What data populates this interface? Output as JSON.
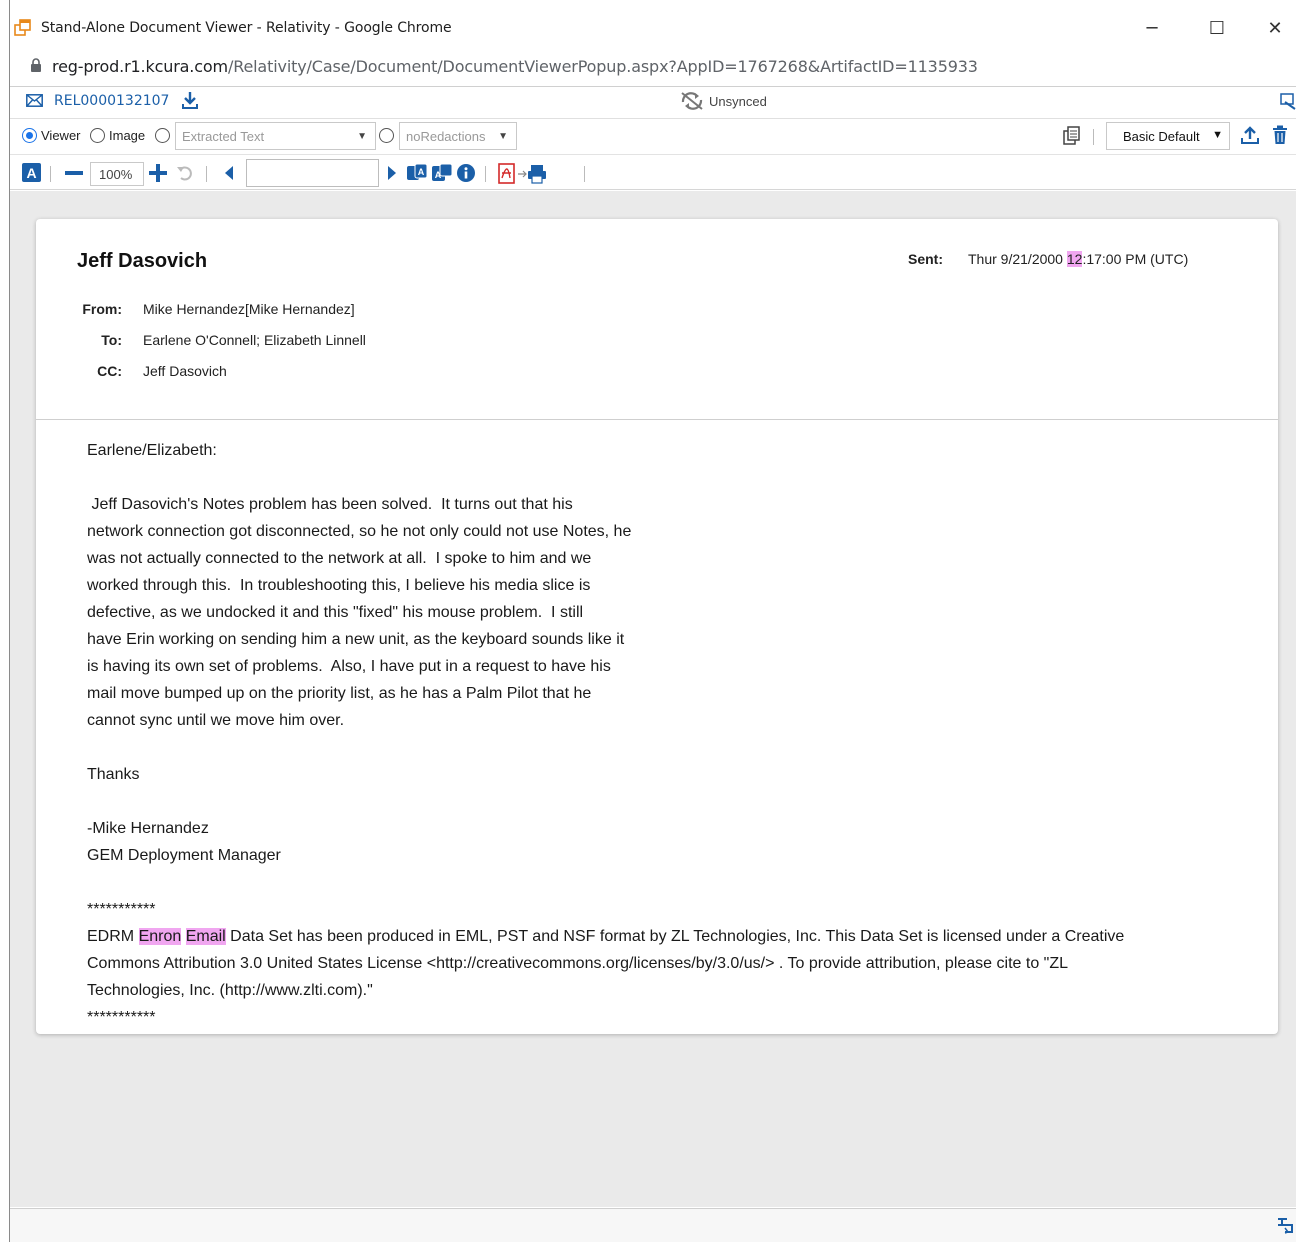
{
  "window": {
    "title": "Stand-Alone Document Viewer - Relativity - Google Chrome",
    "controls": {
      "minimize": "─",
      "maximize": "☐",
      "close": "✕"
    }
  },
  "address": {
    "host": "reg-prod.r1.kcura.com",
    "path": "/Relativity/Case/Document/DocumentViewerPopup.aspx?AppID=1767268&ArtifactID=1135933"
  },
  "doc_header": {
    "document_id": "REL0000132107",
    "sync_status": "Unsynced"
  },
  "view_modes": {
    "viewer_label": "Viewer",
    "image_label": "Image",
    "text_source": "Extracted Text",
    "redaction_set": "noRedactions",
    "selected_mode": "Viewer",
    "layout": "Basic Default"
  },
  "toolbar": {
    "zoom": "100%",
    "page_input": ""
  },
  "email": {
    "sender_name": "Jeff Dasovich",
    "sent_label": "Sent:",
    "sent_prefix": "Thur 9/21/2000 ",
    "sent_highlight": "12",
    "sent_suffix": ":17:00 PM (UTC)",
    "from_label": "From:",
    "from_value": "Mike Hernandez[Mike Hernandez]",
    "to_label": "To:",
    "to_value": "Earlene O'Connell; Elizabeth Linnell",
    "cc_label": "CC:",
    "cc_value": "Jeff Dasovich",
    "body_intro": "Earlene/Elizabeth:\n\n Jeff Dasovich's Notes problem has been solved.  It turns out that his\nnetwork connection got disconnected, so he not only could not use Notes, he\nwas not actually connected to the network at all.  I spoke to him and we\nworked through this.  In troubleshooting this, I believe his media slice is\ndefective, as we undocked it and this \"fixed\" his mouse problem.  I still\nhave Erin working on sending him a new unit, as the keyboard sounds like it\nis having its own set of problems.  Also, I have put in a request to have his\nmail move bumped up on the priority list, as he has a Palm Pilot that he\ncannot sync until we move him over.\n\nThanks\n\n-Mike Hernandez\nGEM Deployment Manager\n\n***********\nEDRM ",
    "hl_word_1": "Enron",
    "hl_word_2": "Email",
    "body_outro": " Data Set has been produced in EML, PST and NSF format by ZL Technologies, Inc. This Data Set is licensed under a Creative\nCommons Attribution 3.0 United States License <http://creativecommons.org/licenses/by/3.0/us/> . To provide attribution, please cite to \"ZL\nTechnologies, Inc. (http://www.zlti.com).\"\n***********"
  },
  "colors": {
    "highlight": "#f0a6f0",
    "link_blue": "#1b5fa8",
    "accent_blue": "#1a73e8",
    "viewer_bg": "#eaeaea"
  },
  "icons": [
    "app-window-icon",
    "lock-icon",
    "mail-icon",
    "download-icon",
    "unsynced-icon",
    "popout-icon",
    "copy-fields-icon",
    "upload-icon",
    "trash-icon",
    "text-toggle-icon",
    "zoom-out-icon",
    "zoom-in-icon",
    "rotate-icon",
    "prev-page-icon",
    "next-page-icon",
    "translate-icon",
    "persistent-highlight-icon",
    "info-icon",
    "pdf-print-icon",
    "dock-icon"
  ]
}
